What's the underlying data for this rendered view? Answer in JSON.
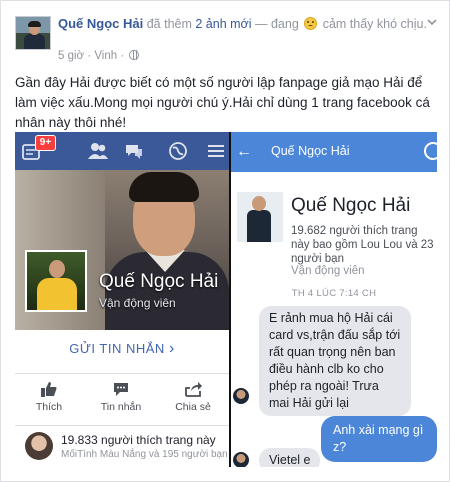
{
  "header": {
    "author": "Quế Ngọc Hải",
    "action_prefix": " đã thêm ",
    "action_link": "2 ảnh mới",
    "feeling_prefix": " — đang ",
    "feeling": " cảm thấy khó chịu.",
    "time": "5 giờ",
    "separator": " · ",
    "location": "Vinh",
    "dot": " · "
  },
  "post": {
    "text": "Gần đây Hải được biết có một số người lập fanpage giả mạo Hải để làm việc xấu.Mong mọi người chú ý.Hải chỉ dùng 1 trang facebook cá nhân này thôi nhé!"
  },
  "left_screenshot": {
    "notification_badge": "9+",
    "page_name": "Quế Ngọc Hải",
    "page_role": "Vận động viên",
    "message_button": "GỬI TIN NHẮN",
    "message_chevron": "›",
    "actions": [
      {
        "label": "Thích",
        "icon": "thumbs-up-icon"
      },
      {
        "label": "Tin nhắn",
        "icon": "chat-icon"
      },
      {
        "label": "Chia sẻ",
        "icon": "share-icon"
      }
    ],
    "likes_main": "19.833 người thích trang này",
    "likes_sub": "MốiTình Màu Nắng và 195 người bạn"
  },
  "right_screenshot": {
    "back": "←",
    "title": "Quế Ngọc Hải",
    "name": "Quế Ngọc Hải",
    "likes": "19.682 người thích trang này bao gồm Lou Lou và 23 người bạn",
    "role": "Vận động viên",
    "timestamp": "TH 4 LÚC 7:14 CH",
    "messages": [
      {
        "from": "in",
        "text": "E rảnh mua hộ Hải cái card vs,trận đấu sắp tới rất quan trọng nên ban điều hành clb ko cho phép ra ngoài! Trưa mai Hải gửi lại"
      },
      {
        "from": "out",
        "text": "Anh xài mạng gì z?"
      },
      {
        "from": "in",
        "text": "Vietel e"
      }
    ]
  },
  "colors": {
    "facebook_blue": "#3b5998",
    "messenger_blue": "#4c86d8",
    "link_blue": "#365899",
    "badge_red": "#fa3e3e"
  }
}
